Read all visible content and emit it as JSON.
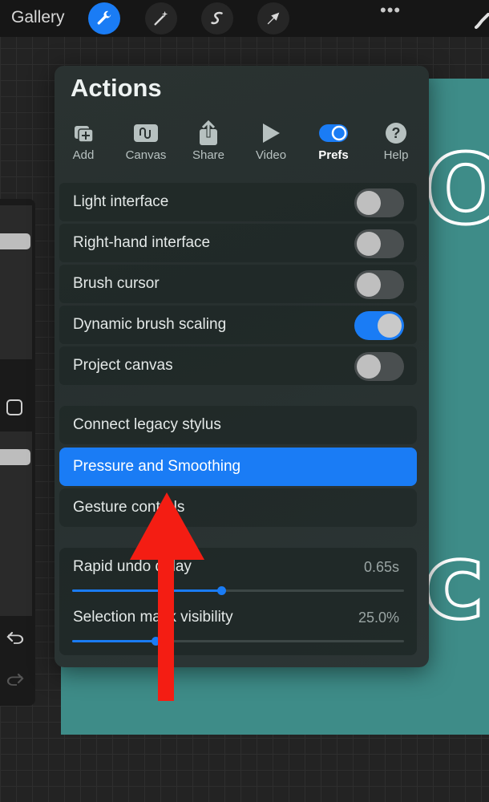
{
  "topbar": {
    "gallery_label": "Gallery",
    "tools": [
      {
        "name": "wrench-icon",
        "state": "active"
      },
      {
        "name": "magic-wand-icon",
        "state": "idle"
      },
      {
        "name": "smudge-s-icon",
        "state": "idle"
      },
      {
        "name": "cursor-arrow-icon",
        "state": "idle"
      }
    ],
    "more_label": "•••"
  },
  "panel": {
    "title": "Actions",
    "tabs": [
      {
        "label": "Add",
        "icon": "add-image-icon"
      },
      {
        "label": "Canvas",
        "icon": "canvas-icon"
      },
      {
        "label": "Share",
        "icon": "share-icon"
      },
      {
        "label": "Video",
        "icon": "play-icon"
      },
      {
        "label": "Prefs",
        "icon": "toggle-icon",
        "selected": true
      },
      {
        "label": "Help",
        "icon": "help-icon"
      }
    ],
    "toggles": [
      {
        "label": "Light interface",
        "on": false
      },
      {
        "label": "Right-hand interface",
        "on": false
      },
      {
        "label": "Brush cursor",
        "on": false
      },
      {
        "label": "Dynamic brush scaling",
        "on": true
      },
      {
        "label": "Project canvas",
        "on": false
      }
    ],
    "menu": [
      {
        "label": "Connect legacy stylus"
      },
      {
        "label": "Pressure and Smoothing",
        "highlighted": true
      },
      {
        "label": "Gesture controls"
      }
    ],
    "sliders": [
      {
        "label": "Rapid undo delay",
        "value": "0.65s",
        "fraction": 0.45
      },
      {
        "label": "Selection mask visibility",
        "value": "25.0%",
        "fraction": 0.25
      }
    ]
  },
  "colors": {
    "accent": "#1a7cf5",
    "canvas": "#3e8c88",
    "annotation": "#f41d13"
  }
}
